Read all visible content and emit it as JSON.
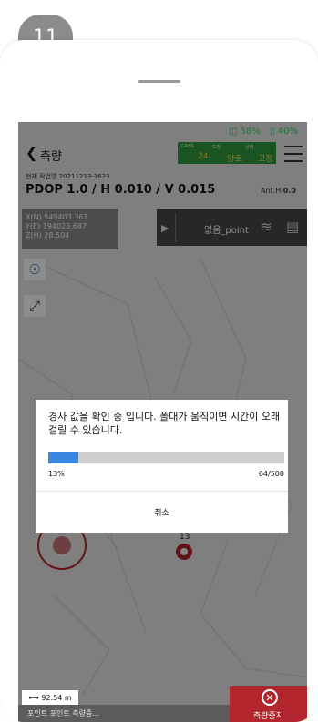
{
  "step_badge": "11",
  "status": {
    "gnss_battery": "58%",
    "device_battery": "40%"
  },
  "header": {
    "back_icon": "chevron-left-icon",
    "title": "측량"
  },
  "gnss_panel": {
    "labels": [
      "GNSS",
      "보정",
      "상태"
    ],
    "values": [
      "24",
      "양호",
      "고정"
    ],
    "color": "#2e9a3e"
  },
  "job_label": "현재 작업명 20211213-1623",
  "precision": "PDOP 1.0 / H 0.010 / V 0.015",
  "antenna": {
    "label": "Ant.H",
    "value": "0.0"
  },
  "coords": [
    "X(N) 549403.361",
    "Y(E) 194023.687",
    "Z(H) 28.504"
  ],
  "point_bar": {
    "name": "없음_point"
  },
  "map_point_label": "13",
  "dialog": {
    "message": "경사 값을 확인 중 입니다. 폴대가 움직이면 시간이 오래 걸릴 수 있습니다.",
    "progress_fraction": 0.128,
    "percent_label": "13%",
    "count_label": "64/500",
    "cancel_label": "취소"
  },
  "scale_bar": "92.54 m",
  "bottom_bar": {
    "text": "포인트 포인트 측량중..."
  },
  "stop_button": {
    "label": "측량중지",
    "color": "#b3262d"
  }
}
